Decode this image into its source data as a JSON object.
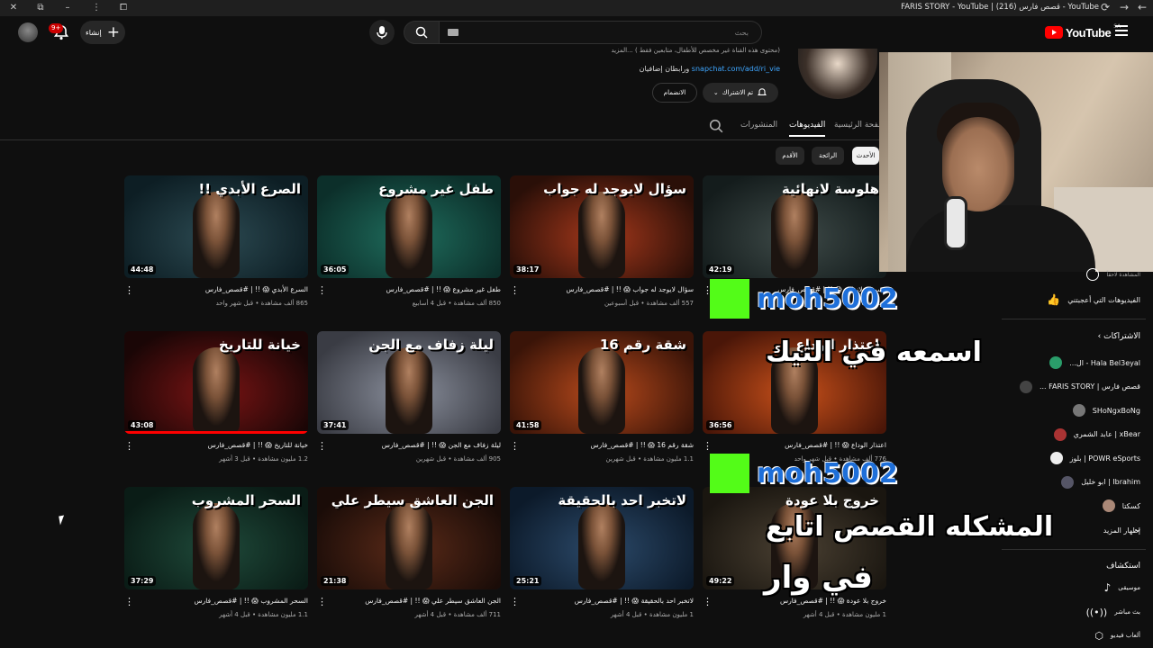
{
  "window": {
    "title": "FARIS STORY - YouTube | قصص فارس (216) - YouTube",
    "close": "✕",
    "restore": "⧉",
    "minimize": "–",
    "more": "⋮"
  },
  "topbar": {
    "notifications_badge": "9+",
    "create_label": "إنشاء",
    "search_placeholder": "بحث",
    "logo_text": "YouTube",
    "logo_region": "SA"
  },
  "channel": {
    "description": "(محتوى هذه القناة غير مخصص للأطفال، متابعين فقط ) ...المزيد",
    "link_url": "snapchat.com/add/ri_vie",
    "link_suffix": "ورابطان إضافيان",
    "subscribed_label": "تم الاشتراك",
    "join_label": "الانضمام"
  },
  "tabs": [
    {
      "label": "صفحة الرئيسية"
    },
    {
      "label": "الفيديوهات"
    },
    {
      "label": "المنشورات"
    }
  ],
  "chips": [
    {
      "label": "الأحدث"
    },
    {
      "label": "الرائجة"
    },
    {
      "label": "الأقدم"
    }
  ],
  "videos": [
    {
      "title": "السرع الأبدي 😱 !! | #قصص_فارس",
      "meta": "865 ألف مشاهدة • قبل شهر واحد",
      "duration": "44:48",
      "thumb_text": "الصرع الأبدي !!",
      "colors": [
        "#2c4a52",
        "#0d1e24"
      ]
    },
    {
      "title": "طفل غير مشروع 😱 !! | #قصص_فارس",
      "meta": "850 ألف مشاهدة • قبل 4 أسابيع",
      "duration": "36:05",
      "thumb_text": "طفل غير مشروع",
      "colors": [
        "#1f6d5d",
        "#0c2f2a"
      ]
    },
    {
      "title": "سؤال لايوجد له جواب 😱 !! | #قصص_فارس",
      "meta": "557 ألف مشاهدة • قبل أسبوعين",
      "duration": "38:17",
      "thumb_text": "سؤال لايوجد له جواب",
      "colors": [
        "#a5381b",
        "#2a0f08"
      ]
    },
    {
      "title": "وسوسة لانهائية 😱 !! | #قصص_فارس",
      "meta": "المشاهدة لاحقاً",
      "duration": "42:19",
      "thumb_text": "هلوسة لانهائية",
      "colors": [
        "#3e4a48",
        "#141c1c"
      ]
    },
    {
      "title": "خيانة للتاريخ 😱 !! | #قصص_فارس",
      "meta": "1.2 مليون مشاهدة • قبل 3 أشهر",
      "duration": "43:08",
      "thumb_text": "خيانة للتاريخ",
      "colors": [
        "#7a1414",
        "#1a0606"
      ]
    },
    {
      "title": "ليلة زفاف مع الجن 😱 !! | #قصص_فارس",
      "meta": "905 ألف مشاهدة • قبل شهرين",
      "duration": "37:41",
      "thumb_text": "ليلة زفاف مع الجن",
      "colors": [
        "#8a8f9c",
        "#3a3c44"
      ]
    },
    {
      "title": "شقة رقم 16 😱 !! | #قصص_فارس",
      "meta": "1.1 مليون مشاهدة • قبل شهرين",
      "duration": "41:58",
      "thumb_text": "شقة رقم 16",
      "colors": [
        "#b84a1c",
        "#3a1408"
      ]
    },
    {
      "title": "اعتذار الوداع 😱 !! | #قصص_فارس",
      "meta": "776 ألف مشاهدة • قبل شهر واحد",
      "duration": "36:56",
      "thumb_text": "اعتذار الوداع",
      "colors": [
        "#c8501a",
        "#4a1608"
      ]
    },
    {
      "title": "السحر المشروب 😱 !! | #قصص_فارس",
      "meta": "1.1 مليون مشاهدة • قبل 4 أشهر",
      "duration": "37:29",
      "thumb_text": "السحر المشروب",
      "colors": [
        "#1f4a3a",
        "#0a1c16"
      ]
    },
    {
      "title": "الجن العاشق سيطر علي 😱 !! | #قصص_فارس",
      "meta": "711 ألف مشاهدة • قبل 4 أشهر",
      "duration": "21:38",
      "thumb_text": "الجن العاشق سيطر علي",
      "colors": [
        "#5a2a18",
        "#1a0c08"
      ]
    },
    {
      "title": "لاتخبر احد بالحقيقة 😱 !! | #قصص_فارس",
      "meta": "1 مليون مشاهدة • قبل 4 أشهر",
      "duration": "25:21",
      "thumb_text": "لاتخبر احد بالحقيقة",
      "colors": [
        "#2c4a6a",
        "#0c1a2a"
      ]
    },
    {
      "title": "خروج بلا عودة 😱 !! | #قصص_فارس",
      "meta": "1 مليون مشاهدة • قبل 4 أشهر",
      "duration": "49:22",
      "thumb_text": "خروج بلا عودة",
      "colors": [
        "#4a4032",
        "#1a1610"
      ]
    }
  ],
  "sidebar": {
    "watch_later": "المشاهدة لاحقاً",
    "liked": "الفيديوهات التي أعجبتني",
    "subscriptions_header": "الاشتراكات",
    "subscriptions": [
      {
        "label": "Hala Bel3eyal - ال...",
        "color": "#2a9d6a"
      },
      {
        "label": "قصص فارس | FARIS STORY ...",
        "color": "#444"
      },
      {
        "label": "SHoNgxBoNg",
        "color": "#777"
      },
      {
        "label": "xBear | عابد الشمري",
        "color": "#a33"
      },
      {
        "label": "POWR eSports | بلوز",
        "color": "#eee"
      },
      {
        "label": "Ibrahim | ابو خليل",
        "color": "#556"
      },
      {
        "label": "كسكتا",
        "color": "#a87"
      }
    ],
    "show_more": "إظهار المزيد",
    "explore_header": "استكشاف",
    "explore": [
      {
        "label": "موسيقى"
      },
      {
        "label": "بث مباشر"
      },
      {
        "label": "ألعاب فيديو"
      }
    ]
  },
  "overlays": {
    "kick_user_1": "moh5002",
    "kick_user_2": "moh5002",
    "line_1": "اسمعه في التيك",
    "line_2": "المشكله القصص اتابع",
    "line_3": "في وار"
  }
}
